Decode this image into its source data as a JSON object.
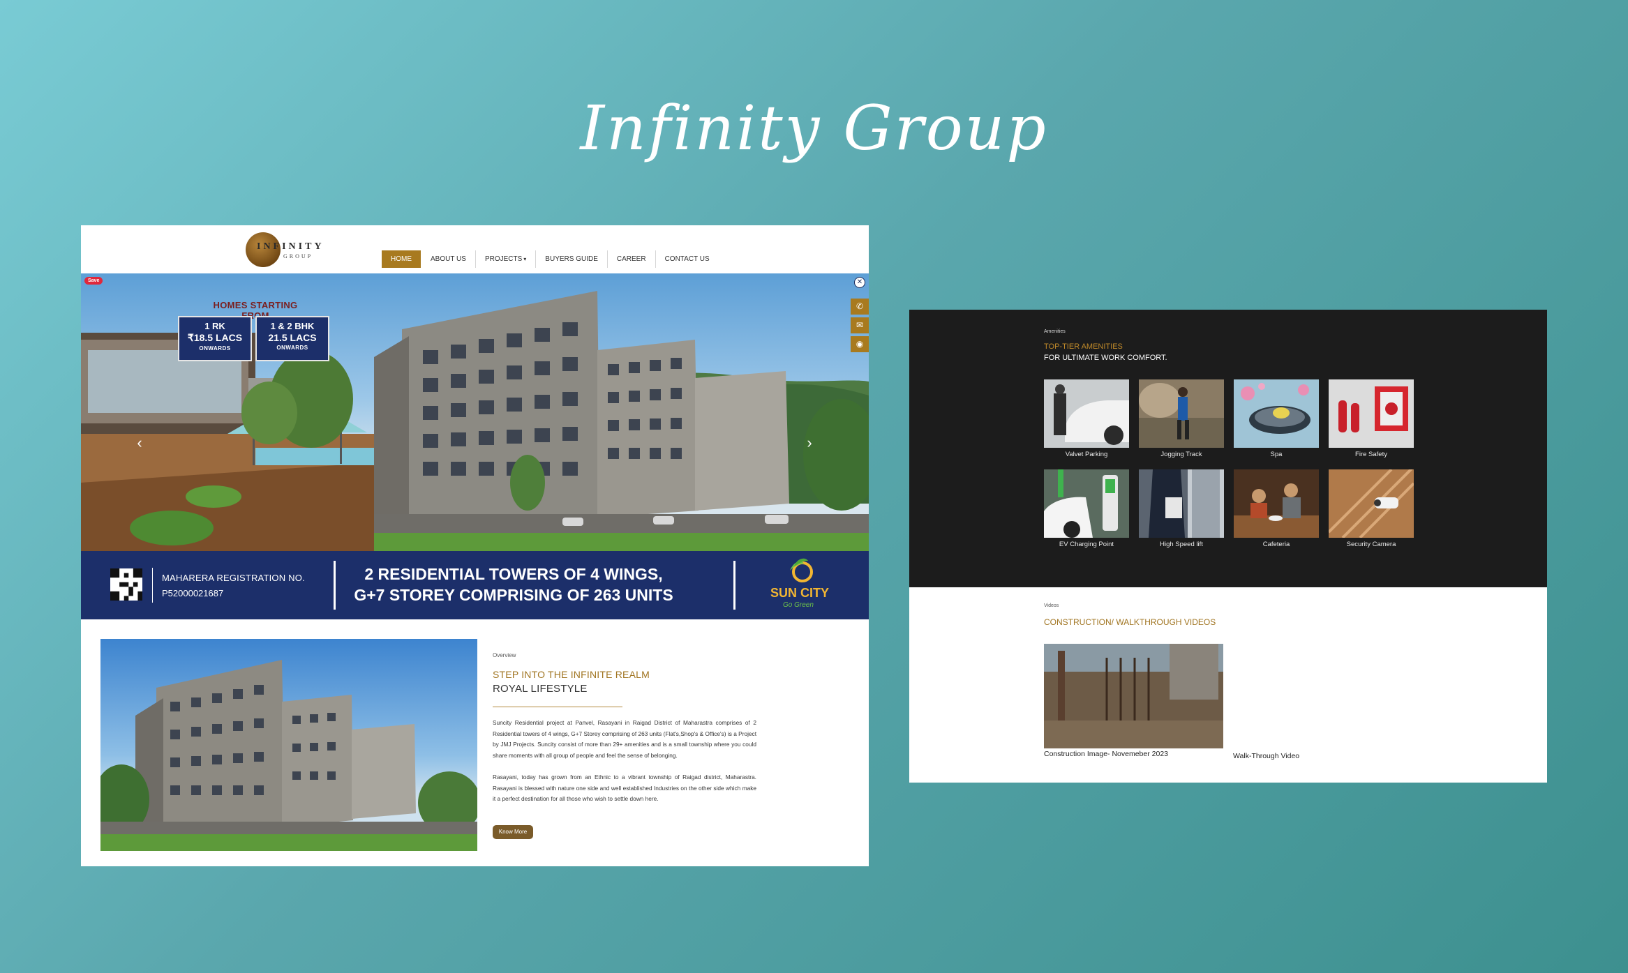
{
  "title": "Infinity Group",
  "site": {
    "logo": {
      "name": "INFINITY",
      "sub": "GROUP",
      "tm": "™"
    },
    "nav": [
      {
        "label": "HOME",
        "active": true
      },
      {
        "label": "ABOUT US"
      },
      {
        "label": "PROJECTS",
        "dropdown": true
      },
      {
        "label": "BUYERS GUIDE"
      },
      {
        "label": "CAREER"
      },
      {
        "label": "CONTACT US"
      }
    ],
    "hero": {
      "save_badge": "Save",
      "promo_heading": "HOMES STARTING FROM",
      "promos": [
        {
          "line1": "1 RK",
          "line2": "₹18.5 LACS",
          "line3": "ONWARDS"
        },
        {
          "line1": "1 & 2 BHK",
          "line2": "21.5 LACS",
          "line3": "ONWARDS"
        }
      ],
      "icons": [
        "close-icon",
        "phone-icon",
        "mail-icon",
        "whatsapp-icon",
        "chevron-left-icon",
        "chevron-right-icon"
      ]
    },
    "banner": {
      "reg_label": "MAHARERA REGISTRATION NO.",
      "reg_number": "P52000021687",
      "headline_1": "2 RESIDENTIAL TOWERS OF 4 WINGS,",
      "headline_2": "G+7 STOREY COMPRISING OF 263 UNITS",
      "brand": "SUN CITY",
      "tagline": "Go Green"
    },
    "overview": {
      "eyebrow": "Overview",
      "title_1": "STEP INTO THE INFINITE REALM",
      "title_2": "ROYAL LIFESTYLE",
      "para_1": "Suncity Residential project at Panvel, Rasayani in Raigad District of Maharastra comprises of 2 Residential towers of 4 wings, G+7 Storey comprising of 263 units (Flat's,Shop's & Office's) is a Project by JMJ Projects. Suncity consist of more than 29+ amenities and is a small township where you could share moments with all group of people and feel the sense of belonging.",
      "para_2": "Rasayani, today has grown from an Ethnic to a vibrant township of Raigad district, Maharastra. Rasayani is blessed with nature one side and well established Industries on the other side which make it a perfect destination for all those who wish to settle down here.",
      "button": "Know More"
    }
  },
  "amenities": {
    "eyebrow": "Amenities",
    "title_1": "TOP-TIER AMENITIES",
    "title_2": "FOR ULTIMATE WORK COMFORT.",
    "items": [
      {
        "label": "Valvet Parking"
      },
      {
        "label": "Jogging Track"
      },
      {
        "label": "Spa"
      },
      {
        "label": "Fire Safety"
      },
      {
        "label": "EV Charging Point"
      },
      {
        "label": "High Speed lift"
      },
      {
        "label": "Cafeteria"
      },
      {
        "label": "Security Camera"
      }
    ]
  },
  "videos": {
    "eyebrow": "Videos",
    "title": "CONSTRUCTION/ WALKTHROUGH VIDEOS",
    "items": [
      {
        "label": "Construction Image- Novemeber 2023"
      },
      {
        "label": "Walk-Through Video"
      }
    ]
  },
  "colors": {
    "accent_gold": "#a87a1f",
    "navy": "#1c2f6a",
    "dark_bg": "#1c1c1c"
  }
}
